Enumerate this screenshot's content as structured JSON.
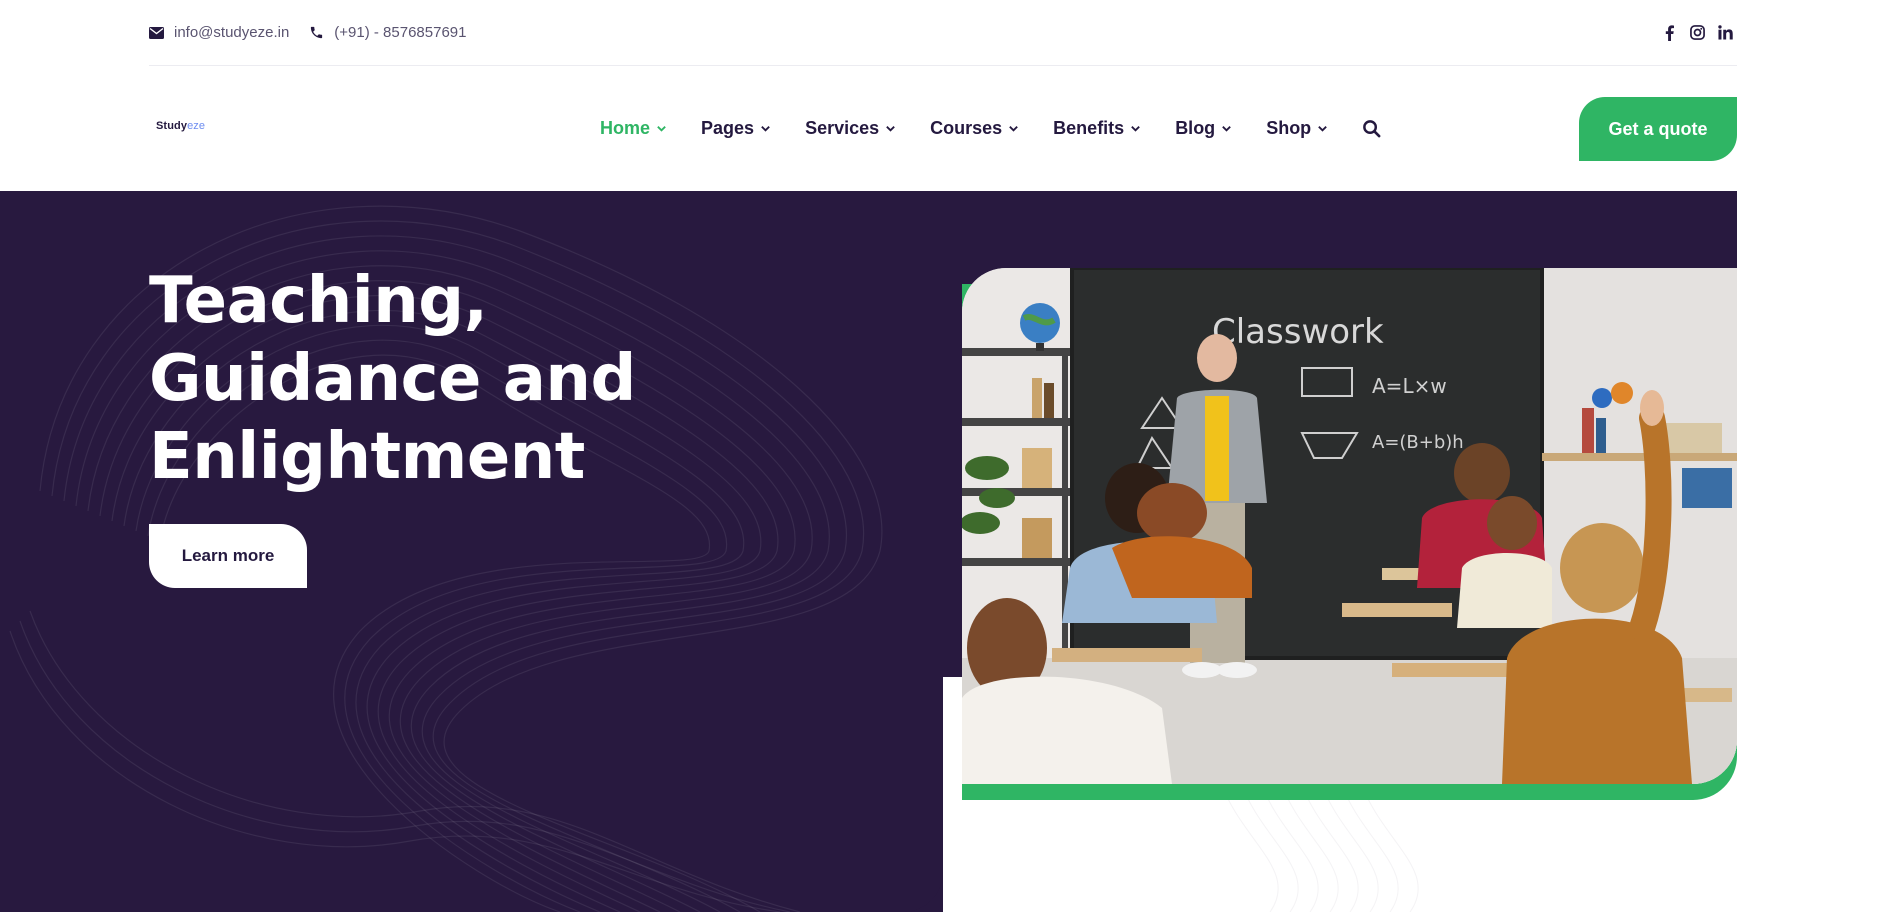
{
  "topbar": {
    "email": "info@studyeze.in",
    "phone": "(+91) - 8576857691",
    "icons": [
      "envelope-icon",
      "phone-icon",
      "facebook-icon",
      "instagram-icon",
      "linkedin-icon"
    ]
  },
  "header": {
    "logo_main": "Study",
    "logo_accent": "eze",
    "nav": [
      {
        "label": "Home",
        "active": true
      },
      {
        "label": "Pages"
      },
      {
        "label": "Services"
      },
      {
        "label": "Courses"
      },
      {
        "label": "Benefits"
      },
      {
        "label": "Blog"
      },
      {
        "label": "Shop"
      }
    ],
    "cta": "Get a quote"
  },
  "hero": {
    "title_line1": "Teaching,",
    "title_line2": "Guidance and",
    "title_line3": "Enlightment",
    "button": "Learn more",
    "image_alt": "Teacher in front of a blackboard with students raising hands",
    "blackboard_text": "Classwork"
  },
  "colors": {
    "brand_dark": "#28193f",
    "accent_green": "#2fb564",
    "text_dark": "#24193f",
    "logo_accent": "#6d8cf0"
  }
}
